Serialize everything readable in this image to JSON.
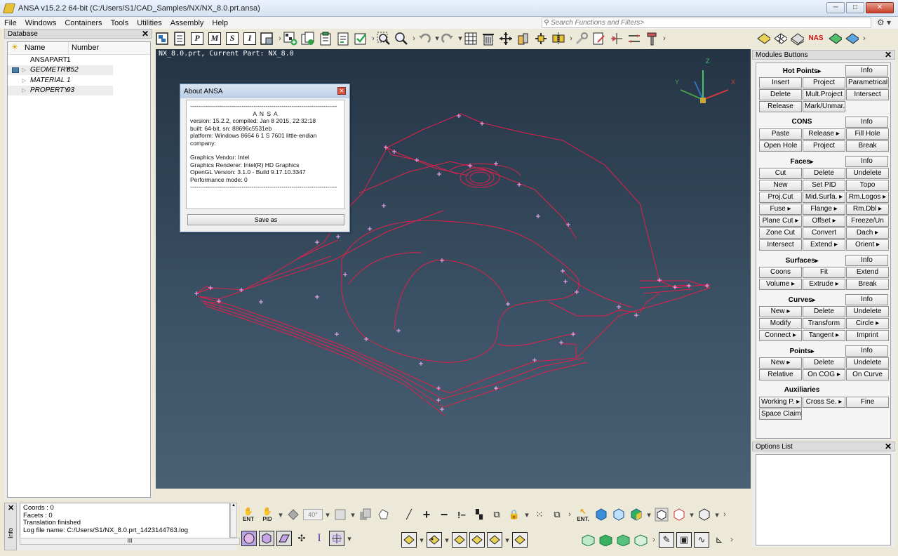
{
  "window": {
    "title": "ANSA v15.2.2 64-bit (C:/Users/S1/CAD_Samples/NX/NX_8.0.prt.ansa)",
    "minimize": "─",
    "maximize": "□",
    "close": "✕"
  },
  "menu": {
    "items": [
      "File",
      "Windows",
      "Containers",
      "Tools",
      "Utilities",
      "Assembly",
      "Help"
    ],
    "search_placeholder": "Search Functions and Filters>",
    "search_icon": "search-icon",
    "gear_label": "⚙ ▾"
  },
  "database": {
    "title": "Database",
    "close": "✕",
    "col_name": "Name",
    "col_number": "Number",
    "rows": [
      {
        "name": "ANSAPART",
        "number": "1"
      },
      {
        "name": "GEOMETRY",
        "number": "852"
      },
      {
        "name": "MATERIAL",
        "number": "1"
      },
      {
        "name": "PROPERTY",
        "number": "93"
      }
    ]
  },
  "viewport": {
    "caption": "NX_8.0.prt,  Current Part: NX_8.0",
    "axis_x": "X",
    "axis_y": "Y",
    "axis_z": "Z",
    "colors": {
      "wire": "#e0204a",
      "bg_top": "#243445",
      "bg_bottom": "#486073"
    }
  },
  "about": {
    "title": "About ANSA",
    "close": "✕",
    "rule": "--------------------------------------------------------------------------",
    "heading": "A N S A",
    "lines": [
      "version:  15.2.2, compiled: Jan  8 2015, 22:32:18",
      "built:    64-bit, sn: 88696c5531eb",
      "platform: Windows 8664 6  1 S 7601 little-endian",
      "company:"
    ],
    "gfx_lines": [
      "Graphics Vendor:   Intel",
      "Graphics Renderer: Intel(R) HD Graphics",
      "OpenGL Version:    3.1.0 - Build 9.17.10.3347",
      "Performance mode:  0"
    ],
    "save_button": "Save as"
  },
  "top_toolbar": {
    "letters": [
      "P",
      "M",
      "S",
      "I"
    ]
  },
  "modules": {
    "title": "Modules Buttons",
    "close": "✕",
    "nas_label": "NAS",
    "groups": [
      {
        "title": "Hot Points",
        "arrow": true,
        "info": "Info",
        "rows": [
          [
            "Insert",
            "Project",
            "Parametrical"
          ],
          [
            "Delete",
            "Mult.Project",
            "Intersect"
          ],
          [
            "Release",
            "Mark/Unmar.",
            ""
          ]
        ]
      },
      {
        "title": "CONS",
        "arrow": false,
        "info": "Info",
        "rows": [
          [
            "Paste",
            "Release ▸",
            "Fill Hole"
          ],
          [
            "Open Hole",
            "Project",
            "Break"
          ]
        ]
      },
      {
        "title": "Faces",
        "arrow": true,
        "info": "Info",
        "rows": [
          [
            "Cut",
            "Delete",
            "Undelete"
          ],
          [
            "New",
            "Set PID",
            "Topo"
          ],
          [
            "Proj.Cut",
            "Mid.Surfa. ▸",
            "Rm.Logos ▸"
          ],
          [
            "Fuse ▸",
            "Flange ▸",
            "Rm.Dbl ▸"
          ],
          [
            "Plane Cut ▸",
            "Offset ▸",
            "Freeze/Un"
          ],
          [
            "Zone Cut",
            "Convert",
            "Dach ▸"
          ],
          [
            "Intersect",
            "Extend ▸",
            "Orient ▸"
          ]
        ]
      },
      {
        "title": "Surfaces",
        "arrow": true,
        "info": "Info",
        "rows": [
          [
            "Coons",
            "Fit",
            "Extend"
          ],
          [
            "Volume ▸",
            "Extrude ▸",
            "Break"
          ]
        ]
      },
      {
        "title": "Curves",
        "arrow": true,
        "info": "Info",
        "rows": [
          [
            "New ▸",
            "Delete",
            "Undelete"
          ],
          [
            "Modify",
            "Transform",
            "Circle ▸"
          ],
          [
            "Connect ▸",
            "Tangent ▸",
            "Imprint"
          ]
        ]
      },
      {
        "title": "Points",
        "arrow": true,
        "info": "Info",
        "rows": [
          [
            "New ▸",
            "Delete",
            "Undelete"
          ],
          [
            "Relative",
            "On COG ▸",
            "On Curve"
          ]
        ]
      },
      {
        "title": "Auxiliaries",
        "arrow": false,
        "info": "",
        "rows": [
          [
            "Working P. ▸",
            "Cross Se. ▸",
            "Fine"
          ],
          [
            "Space Claim",
            "",
            ""
          ]
        ]
      }
    ]
  },
  "options": {
    "title": "Options List",
    "close": "✕"
  },
  "info": {
    "tab_label": "Info",
    "close": "✕",
    "lines": [
      "Coords   : 0",
      "Facets    : 0",
      "Translation finished",
      "Log file name: C:/Users/S1/NX_8.0.prt_1423144763.log"
    ],
    "scroll_label": "III"
  },
  "bottom_toolbar": {
    "ent_label": "ENT",
    "pid_label": "PID",
    "angle_value": "40°",
    "ent2_label": "ENT."
  }
}
